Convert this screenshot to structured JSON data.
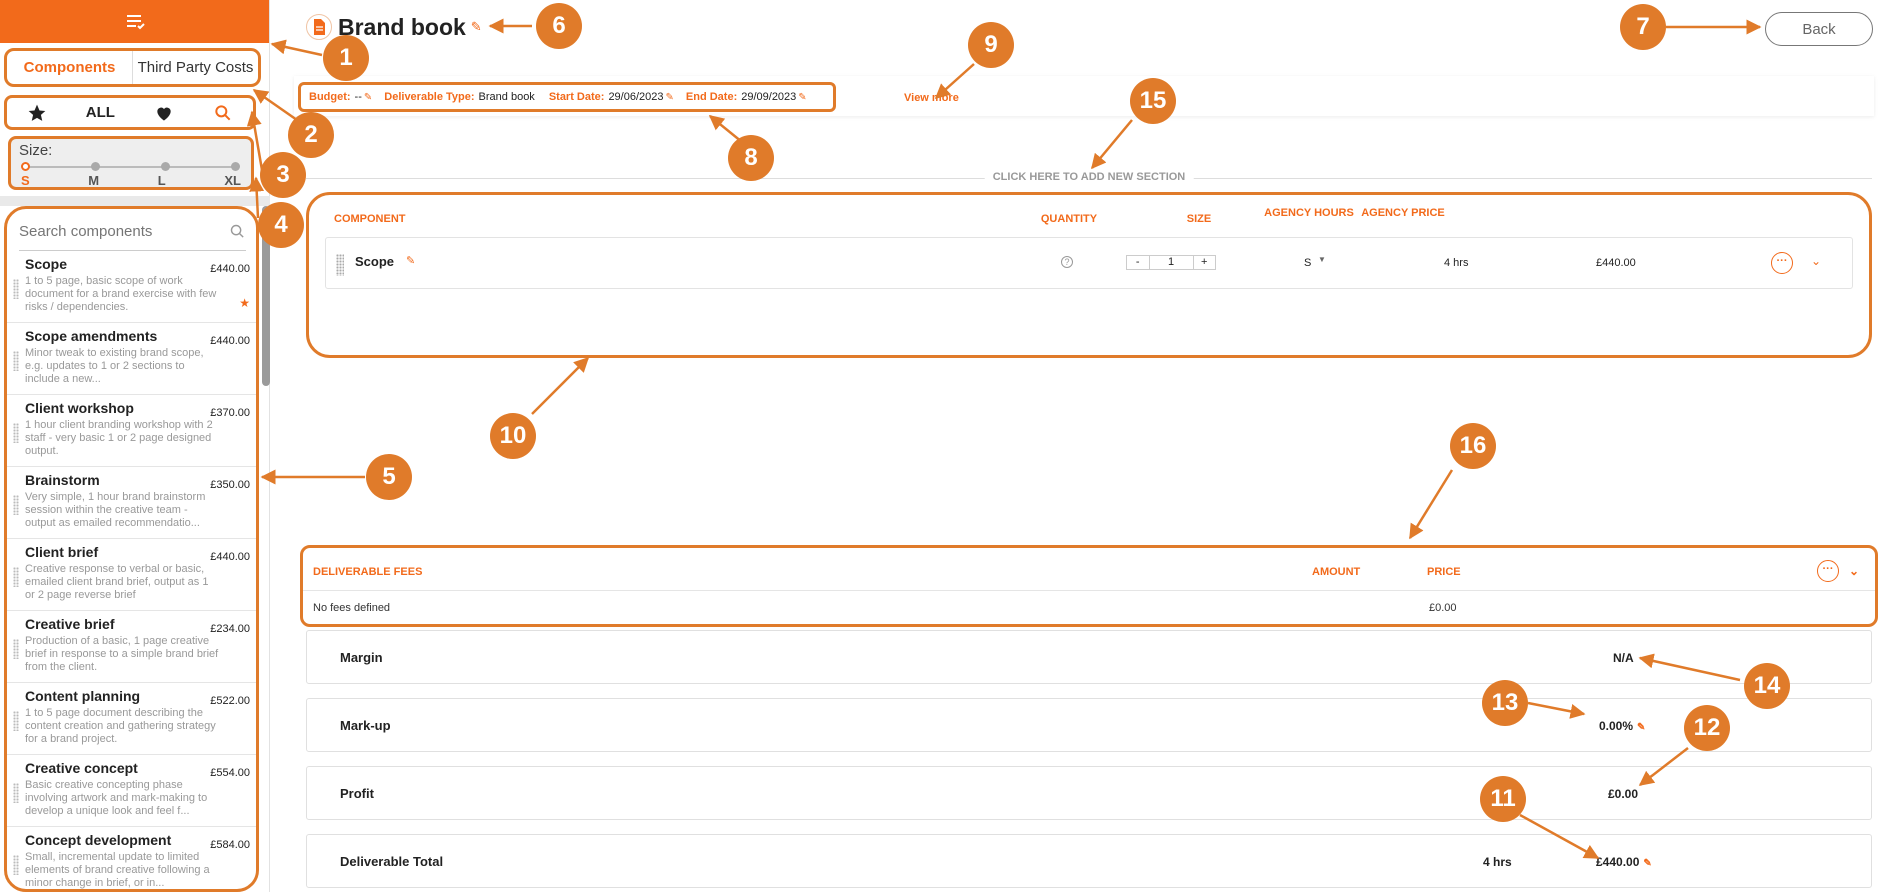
{
  "sidebar": {
    "tabs": [
      "Components",
      "Third Party Costs"
    ],
    "filter_all": "ALL",
    "size_label": "Size:",
    "sizes": [
      "S",
      "M",
      "L",
      "XL"
    ],
    "search_placeholder": "Search components",
    "items": [
      {
        "name": "Scope",
        "price": "£440.00",
        "desc": "1 to 5 page, basic scope of work document for a brand exercise with few risks / dependencies."
      },
      {
        "name": "Scope amendments",
        "price": "£440.00",
        "desc": "Minor tweak to existing brand scope, e.g. updates to 1 or 2 sections to include a new..."
      },
      {
        "name": "Client workshop",
        "price": "£370.00",
        "desc": "1 hour client branding workshop with 2 staff - very basic 1 or 2 page designed output."
      },
      {
        "name": "Brainstorm",
        "price": "£350.00",
        "desc": "Very simple, 1 hour brand brainstorm session within the creative team - output as emailed recommendatio..."
      },
      {
        "name": "Client brief",
        "price": "£440.00",
        "desc": "Creative response to verbal or basic, emailed client brand brief, output as 1 or 2 page reverse brief"
      },
      {
        "name": "Creative brief",
        "price": "£234.00",
        "desc": "Production of a basic, 1 page creative brief in response to a simple brand brief from the client."
      },
      {
        "name": "Content planning",
        "price": "£522.00",
        "desc": "1 to 5 page document describing the content creation and gathering strategy for a brand project."
      },
      {
        "name": "Creative concept",
        "price": "£554.00",
        "desc": "Basic creative concepting phase involving artwork and mark-making to develop a unique look and feel f..."
      },
      {
        "name": "Concept development",
        "price": "£584.00",
        "desc": "Small, incremental update to limited elements of brand creative following a minor change in brief, or in..."
      }
    ]
  },
  "header": {
    "title": "Brand book",
    "back_label": "Back"
  },
  "meta": {
    "budget_label": "Budget:",
    "budget_value": "--",
    "type_label": "Deliverable Type:",
    "type_value": "Brand book",
    "start_label": "Start Date:",
    "start_value": "29/06/2023",
    "end_label": "End Date:",
    "end_value": "29/09/2023",
    "view_more": "View more"
  },
  "add_section": "CLICK HERE TO ADD NEW SECTION",
  "components": {
    "headers": {
      "component": "COMPONENT",
      "quantity": "QUANTITY",
      "size": "SIZE",
      "hours": "AGENCY HOURS",
      "price": "AGENCY PRICE"
    },
    "row": {
      "name": "Scope",
      "help": "?",
      "minus": "-",
      "qty": "1",
      "plus": "+",
      "size": "S",
      "hours": "4 hrs",
      "price": "£440.00",
      "more": "···"
    }
  },
  "fees": {
    "title": "DELIVERABLE FEES",
    "amount": "AMOUNT",
    "price": "PRICE",
    "empty": "No fees defined",
    "empty_price": "£0.00",
    "more": "···"
  },
  "summary": {
    "margin_label": "Margin",
    "margin_value": "N/A",
    "markup_label": "Mark-up",
    "markup_value": "0.00%",
    "profit_label": "Profit",
    "profit_value": "£0.00",
    "total_label": "Deliverable Total",
    "total_hours": "4 hrs",
    "total_value": "£440.00"
  },
  "callouts": [
    "1",
    "2",
    "3",
    "4",
    "5",
    "6",
    "7",
    "8",
    "9",
    "10",
    "11",
    "12",
    "13",
    "14",
    "15",
    "16"
  ],
  "colors": {
    "accent": "#f26a1b",
    "callout": "#e07b2a"
  },
  "icons": [
    "menu-icon",
    "star-icon",
    "heart-icon",
    "search-icon",
    "document-icon",
    "pencil-icon",
    "help-icon",
    "more-icon",
    "chevron-down-icon",
    "drag-handle-icon"
  ]
}
